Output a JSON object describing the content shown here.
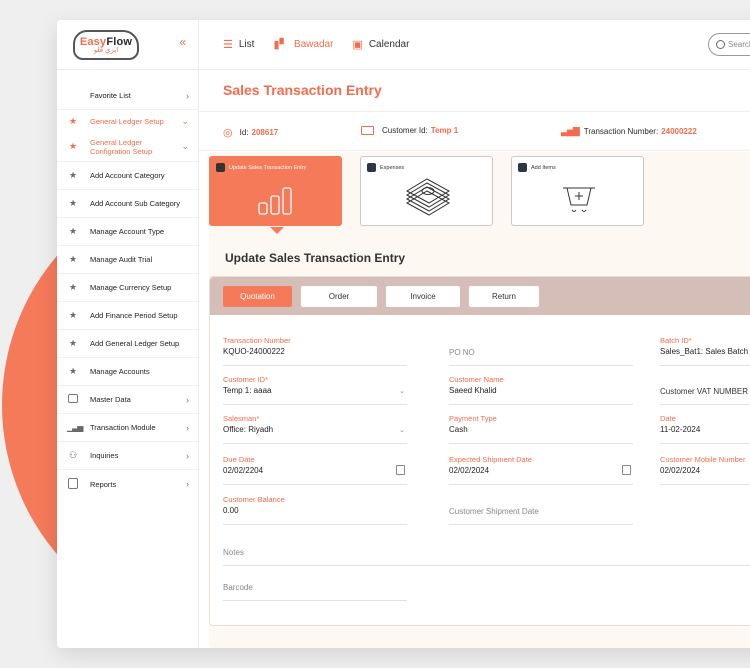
{
  "brand": {
    "name_prefix": "Easy",
    "name_suffix": "Flow",
    "arabic": "ايزي فلو"
  },
  "sidebar": {
    "items": [
      {
        "label": "Favorite List",
        "icon": "none",
        "chevron": "›"
      },
      {
        "label": "General Ledger Setup",
        "icon": "star-icon",
        "chevron": "⌄",
        "active": true
      },
      {
        "label": "General Ledger Configration Setup",
        "icon": "star-icon",
        "chevron": "⌄",
        "active": true
      },
      {
        "label": "Add Account Category",
        "icon": "star-icon"
      },
      {
        "label": "Add Account Sub Category",
        "icon": "star-icon"
      },
      {
        "label": "Manage Account Type",
        "icon": "star-icon"
      },
      {
        "label": "Manage Audit Trial",
        "icon": "star-icon"
      },
      {
        "label": "Manage Currency Setup",
        "icon": "star-icon"
      },
      {
        "label": "Add Finance Period Setup",
        "icon": "star-icon"
      },
      {
        "label": "Add General Ledger Setup",
        "icon": "star-icon"
      },
      {
        "label": "Manage Accounts",
        "icon": "star-icon"
      },
      {
        "label": "Master Data",
        "icon": "master-data-icon",
        "chevron": "›"
      },
      {
        "label": "Transaction Module",
        "icon": "bar-chart-icon",
        "chevron": "›"
      },
      {
        "label": "Inquiries",
        "icon": "users-icon",
        "chevron": "›"
      },
      {
        "label": "Reports",
        "icon": "clipboard-icon",
        "chevron": "›"
      }
    ]
  },
  "topbar": {
    "tabs": [
      {
        "label": "List",
        "icon": "list-icon"
      },
      {
        "label": "Bawadar",
        "icon": "kanban-icon",
        "active": true
      },
      {
        "label": "Calendar",
        "icon": "calendar-icon"
      }
    ],
    "search_placeholder": "Search"
  },
  "page": {
    "title": "Sales Transaction Entry",
    "info": {
      "id_label": "Id:",
      "id_value": "208617",
      "customer_label": "Customer Id:",
      "customer_value": "Temp 1",
      "txn_label": "Transaction Number:",
      "txn_value": "24000222"
    },
    "cards": [
      {
        "label": "Update Sales Transaction Entry",
        "icon": "bar-chart-icon",
        "active": true
      },
      {
        "label": "Expenses",
        "icon": "money-stack-icon"
      },
      {
        "label": "Add Items",
        "icon": "cart-add-icon"
      }
    ],
    "section_title": "Update Sales Transaction Entry",
    "steps": [
      "Quotation",
      "Order",
      "Invoice",
      "Return"
    ],
    "fields": {
      "transaction_number": {
        "label": "Transaction Number",
        "value": "KQUO-24000222"
      },
      "po_no": {
        "placeholder": "PO NO"
      },
      "batch_id": {
        "label": "Batch ID*",
        "value": "Sales_Bat1: Sales Batch"
      },
      "customer_id": {
        "label": "Customer ID*",
        "value": "Temp 1: aaaa"
      },
      "customer_name": {
        "label": "Customer Name",
        "value": "Saeed Khalid"
      },
      "customer_vat": {
        "placeholder": "Customer VAT NUMBER"
      },
      "salesman": {
        "label": "Salesman*",
        "value": "Office: Riyadh"
      },
      "payment_type": {
        "label": "Payment Type",
        "value": "Cash"
      },
      "date": {
        "label": "Date",
        "value": "11-02-2024"
      },
      "due_date": {
        "label": "Due Date",
        "value": "02/02/2204"
      },
      "expected_shipment_date": {
        "label": "Expected Shipment Date",
        "value": "02/02/2024"
      },
      "customer_mobile": {
        "label": "Customer Mobile Number",
        "value": "02/02/2024"
      },
      "customer_balance": {
        "label": "Customer Balance",
        "value": "0.00"
      },
      "customer_shipment_date": {
        "placeholder": "Customer Shipment Date"
      },
      "notes": {
        "placeholder": "Notes"
      },
      "barcode": {
        "placeholder": "Barcode"
      }
    }
  },
  "colors": {
    "accent": "#f36c4d",
    "blob": "#f47a5a",
    "steps_bg": "#d5bdb8",
    "cream": "#fdf8f2"
  }
}
